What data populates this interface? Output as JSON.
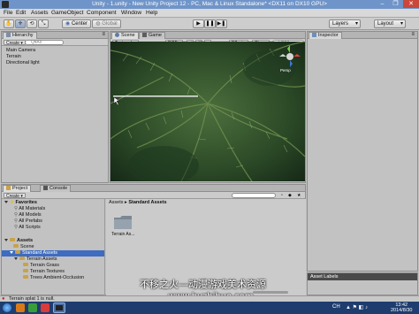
{
  "window": {
    "title": "Unity - 1.unity - New Unity Project 12 - PC, Mac & Linux Standalone* <DX11 on DX10 GPU>",
    "controls": [
      "–",
      "❐",
      "✕"
    ]
  },
  "menu": [
    "File",
    "Edit",
    "Assets",
    "GameObject",
    "Component",
    "Window",
    "Help"
  ],
  "toolbar": {
    "transform_tools": [
      "✋",
      "✛",
      "⟲",
      "⤡"
    ],
    "pivot": "Center",
    "space": "Global",
    "playback": [
      "▶",
      "❚❚",
      "▶❚"
    ],
    "layers": "Layers",
    "layout": "Layout"
  },
  "hierarchy": {
    "tab": "Hierarchy",
    "create": "Create ▾",
    "search_placeholder": "Q▾All",
    "items": [
      "Main Camera",
      "Terrain",
      "Directional light"
    ]
  },
  "scene": {
    "tabs": [
      "Scene",
      "Game"
    ],
    "render_mode": "Textured",
    "color_mode": "RGB",
    "effects": "Effects ▾",
    "gizmos": "Gizmos ▾",
    "search_placeholder": "Q▾All",
    "gizmo_label": "Persp"
  },
  "inspector": {
    "tab": "Inspector"
  },
  "project": {
    "tabs": [
      "Project",
      "Console"
    ],
    "create": "Create ▾",
    "favorites": {
      "label": "Favorites",
      "items": [
        "All Materials",
        "All Models",
        "All Prefabs",
        "All Scripts"
      ]
    },
    "assets": {
      "label": "Assets",
      "items": [
        "Scene",
        "Standard Assets",
        "Terrain Assets",
        "Terrain Grass",
        "Terrain Textures",
        "Trees Ambient-Occlusion"
      ]
    },
    "breadcrumb": [
      "Assets",
      "Standard Assets"
    ],
    "grid_items": [
      "Terrain As..."
    ]
  },
  "asset_labels": "Asset Labels",
  "status_text": "Terrain splat 1 is null.",
  "watermark": {
    "line1": "不移之火—动漫游戏美术资源",
    "line2": "www.byzhihuo.com"
  },
  "taskbar": {
    "lang": "CH",
    "time": "13:42",
    "date": "2014/8/30"
  },
  "colors": {
    "title_bar": "#6f94c9",
    "selection": "#3d6cc0",
    "taskbar": "#1e3d6e",
    "folder": "#c9a24a"
  }
}
